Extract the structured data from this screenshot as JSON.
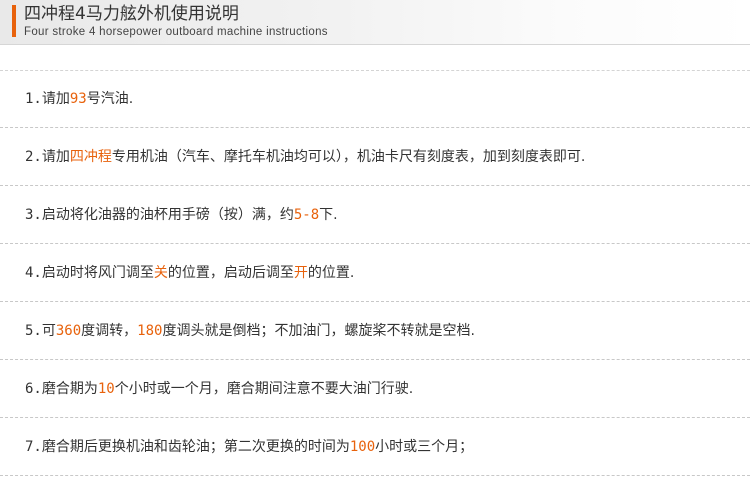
{
  "header": {
    "title": "四冲程4马力舷外机使用说明",
    "subtitle": "Four stroke 4 horsepower outboard machine instructions",
    "accent_color": "#e8620c"
  },
  "instructions": [
    {
      "segments": [
        {
          "t": "1.",
          "c": "num"
        },
        {
          "t": "请加"
        },
        {
          "t": "93",
          "c": "hl"
        },
        {
          "t": "号汽油."
        }
      ]
    },
    {
      "segments": [
        {
          "t": "2.",
          "c": "num"
        },
        {
          "t": "请加"
        },
        {
          "t": "四冲程",
          "c": "hlcn"
        },
        {
          "t": "专用机油（汽车、摩托车机油均可以），机油卡尺有刻度表，加到刻度表即可."
        }
      ]
    },
    {
      "segments": [
        {
          "t": "3.",
          "c": "num"
        },
        {
          "t": "启动将化油器的油杯用手磅（按）满，约"
        },
        {
          "t": "5-8",
          "c": "hl"
        },
        {
          "t": "下."
        }
      ]
    },
    {
      "segments": [
        {
          "t": "4.",
          "c": "num"
        },
        {
          "t": "启动时将风门调至"
        },
        {
          "t": "关",
          "c": "hlcn"
        },
        {
          "t": "的位置，启动后调至"
        },
        {
          "t": "开",
          "c": "hlcn"
        },
        {
          "t": "的位置."
        }
      ]
    },
    {
      "segments": [
        {
          "t": "5.",
          "c": "num"
        },
        {
          "t": "可"
        },
        {
          "t": "360",
          "c": "hl"
        },
        {
          "t": "度调转，"
        },
        {
          "t": "180",
          "c": "hl"
        },
        {
          "t": "度调头就是倒档；不加油门，螺旋桨不转就是空档."
        }
      ]
    },
    {
      "segments": [
        {
          "t": "6.",
          "c": "num"
        },
        {
          "t": "磨合期为"
        },
        {
          "t": "10",
          "c": "hl"
        },
        {
          "t": "个小时或一个月，磨合期间注意不要大油门行驶."
        }
      ]
    },
    {
      "segments": [
        {
          "t": "7.",
          "c": "num"
        },
        {
          "t": "磨合期后更换机油和齿轮油；第二次更换的时间为"
        },
        {
          "t": "100",
          "c": "hl"
        },
        {
          "t": "小时或三个月；"
        }
      ]
    }
  ]
}
